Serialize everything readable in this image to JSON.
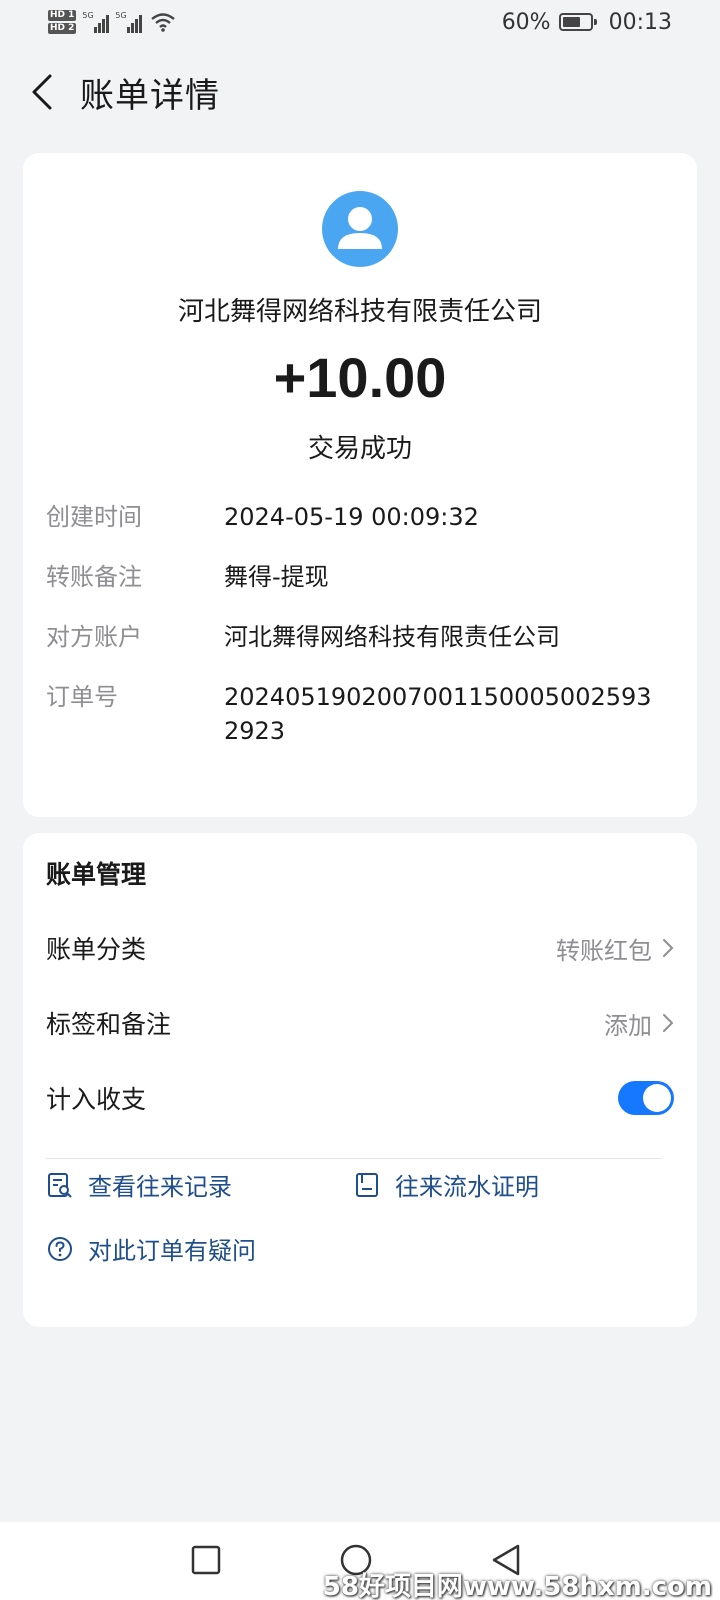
{
  "status_bar": {
    "hd1": "HD 1",
    "hd2": "HD 2",
    "net1": "5G",
    "net2": "5G",
    "battery_pct": "60%",
    "time": "00:13"
  },
  "header": {
    "title": "账单详情"
  },
  "transaction": {
    "merchant": "河北舞得网络科技有限责任公司",
    "amount": "+10.00",
    "status": "交易成功",
    "details": [
      {
        "label": "创建时间",
        "value": "2024-05-19 00:09:32"
      },
      {
        "label": "转账备注",
        "value": "舞得-提现"
      },
      {
        "label": "对方账户",
        "value": "河北舞得网络科技有限责任公司"
      },
      {
        "label": "订单号",
        "value": "20240519020070011500050025932923"
      }
    ]
  },
  "management": {
    "title": "账单管理",
    "category_label": "账单分类",
    "category_value": "转账红包",
    "tags_label": "标签和备注",
    "tags_value": "添加",
    "include_label": "计入收支",
    "include_enabled": true,
    "links": {
      "history": "查看往来记录",
      "proof": "往来流水证明",
      "question": "对此订单有疑问"
    }
  },
  "watermark": "58好项目网www.58hxm.com",
  "colors": {
    "accent": "#1677ff",
    "link": "#1f4e8c",
    "avatar": "#4aa6f0",
    "muted": "#8e8e93"
  }
}
